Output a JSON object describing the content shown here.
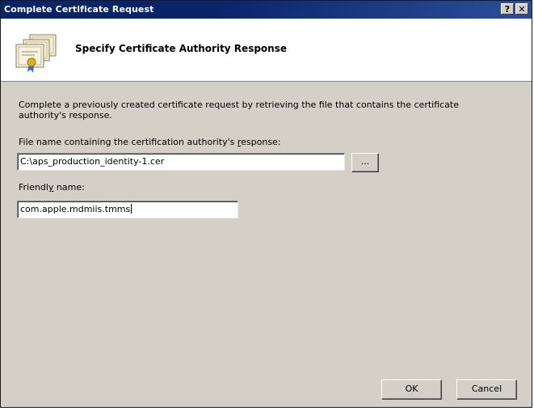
{
  "window": {
    "title": "Complete Certificate Request",
    "help_button": "?",
    "close_button": "✕"
  },
  "header": {
    "heading": "Specify Certificate Authority Response",
    "icon": "certificate-stack-icon"
  },
  "main": {
    "description": "Complete a previously created certificate request by retrieving the file that contains the certificate authority's response.",
    "file_label_prefix": "File name containing the certification authority's ",
    "file_label_accel": "r",
    "file_label_suffix": "esponse:",
    "file_value": "C:\\aps_production_identity-1.cer",
    "browse_label": "...",
    "friendly_label_prefix": "Friendl",
    "friendly_label_accel": "y",
    "friendly_label_suffix": " name:",
    "friendly_value": "com.apple.mdmiis.tmms"
  },
  "footer": {
    "ok_label": "OK",
    "cancel_label": "Cancel"
  },
  "colors": {
    "titlebar": "#0a246a",
    "dialog_face": "#d4d0c8",
    "header_bg": "#ffffff"
  }
}
